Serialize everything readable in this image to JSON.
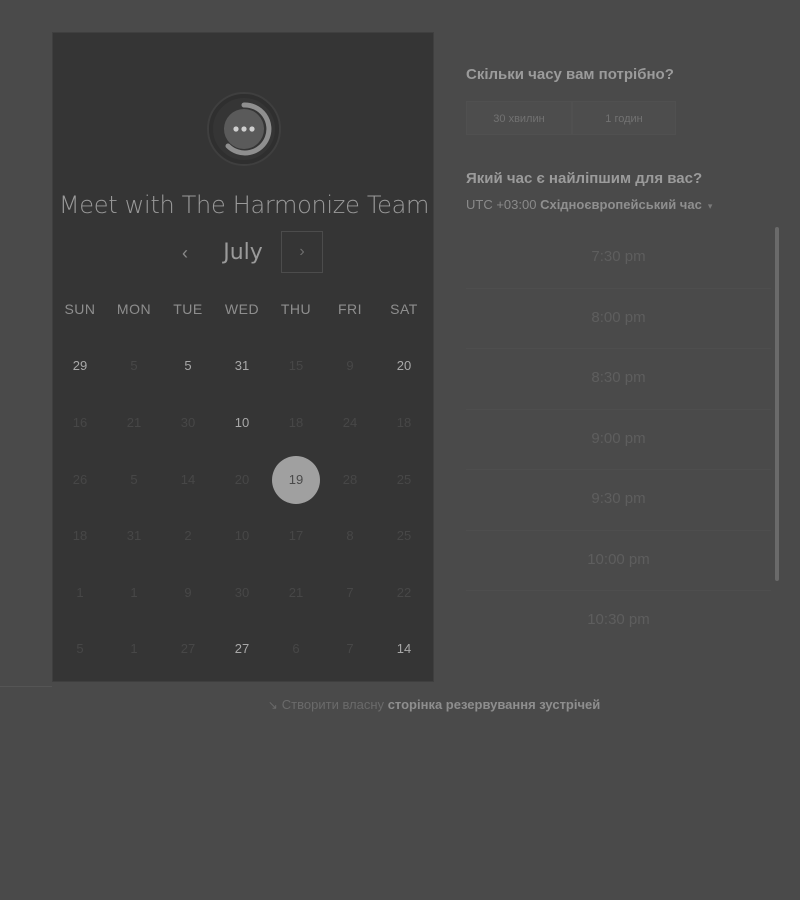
{
  "calendar": {
    "title": "Meet with The Harmonize Team",
    "month": "July",
    "prev_icon": "‹",
    "next_icon": "›",
    "weekdays": [
      "SUN",
      "MON",
      "TUE",
      "WED",
      "THU",
      "FRI",
      "SAT"
    ],
    "weeks": [
      [
        {
          "d": "29",
          "a": true
        },
        {
          "d": "5",
          "a": false
        },
        {
          "d": "5",
          "a": true
        },
        {
          "d": "31",
          "a": true
        },
        {
          "d": "15",
          "a": false
        },
        {
          "d": "9",
          "a": false
        },
        {
          "d": "20",
          "a": true
        }
      ],
      [
        {
          "d": "16",
          "a": false
        },
        {
          "d": "21",
          "a": false
        },
        {
          "d": "30",
          "a": false
        },
        {
          "d": "10",
          "a": true
        },
        {
          "d": "18",
          "a": false
        },
        {
          "d": "24",
          "a": false
        },
        {
          "d": "18",
          "a": false
        }
      ],
      [
        {
          "d": "26",
          "a": false
        },
        {
          "d": "5",
          "a": false
        },
        {
          "d": "14",
          "a": false
        },
        {
          "d": "20",
          "a": false
        },
        {
          "d": "19",
          "a": true,
          "selected": true
        },
        {
          "d": "28",
          "a": false
        },
        {
          "d": "25",
          "a": false
        }
      ],
      [
        {
          "d": "18",
          "a": false
        },
        {
          "d": "31",
          "a": false
        },
        {
          "d": "2",
          "a": false
        },
        {
          "d": "10",
          "a": false
        },
        {
          "d": "17",
          "a": false
        },
        {
          "d": "8",
          "a": false
        },
        {
          "d": "25",
          "a": false
        }
      ],
      [
        {
          "d": "1",
          "a": false
        },
        {
          "d": "1",
          "a": false
        },
        {
          "d": "9",
          "a": false
        },
        {
          "d": "30",
          "a": false
        },
        {
          "d": "21",
          "a": false
        },
        {
          "d": "7",
          "a": false
        },
        {
          "d": "22",
          "a": false
        }
      ],
      [
        {
          "d": "5",
          "a": false
        },
        {
          "d": "1",
          "a": false
        },
        {
          "d": "27",
          "a": false
        },
        {
          "d": "27",
          "a": true
        },
        {
          "d": "6",
          "a": false
        },
        {
          "d": "7",
          "a": false
        },
        {
          "d": "14",
          "a": true
        }
      ]
    ]
  },
  "booking": {
    "duration_question": "Скільки часу вам потрібно?",
    "durations": [
      "30 хвилин",
      "1 годин"
    ],
    "time_question": "Який час є найліпшим для вас?",
    "timezone_offset": "UTC +03:00",
    "timezone_name": "Східноєвропейський час",
    "timezone_caret": "▾",
    "slots": [
      "7:30 pm",
      "8:00 pm",
      "8:30 pm",
      "9:00 pm",
      "9:30 pm",
      "10:00 pm",
      "10:30 pm"
    ]
  },
  "footer": {
    "arrow": "↘",
    "text": "Створити власну",
    "link": "сторінка резервування зустрічей"
  }
}
